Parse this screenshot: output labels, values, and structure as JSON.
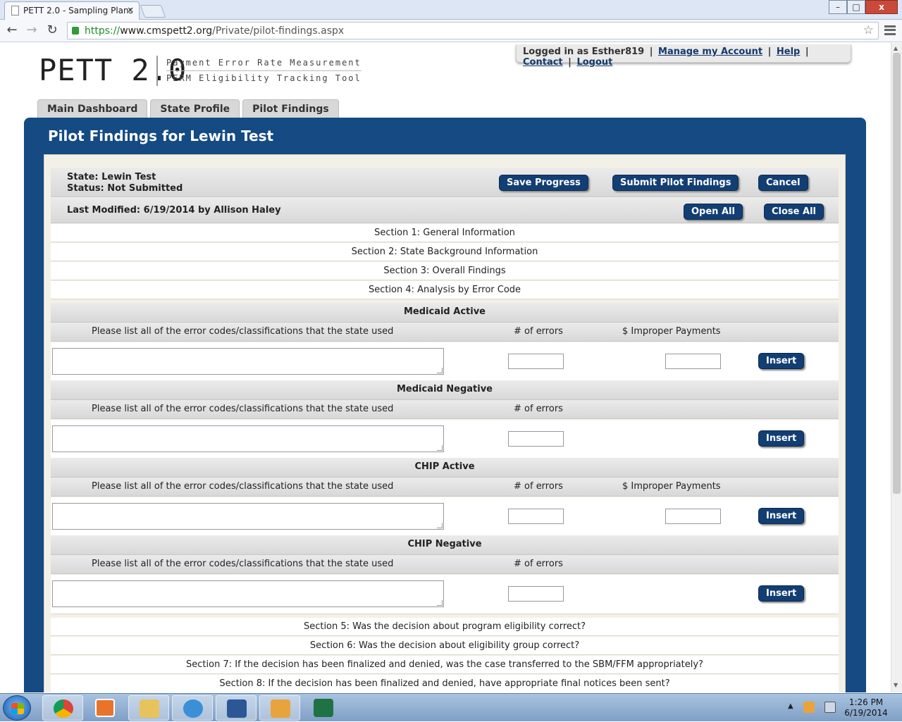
{
  "browser": {
    "tab_title": "PETT 2.0 - Sampling Plans",
    "tab_close": "×",
    "url_protocol": "https://",
    "url_domain": "www.cmspett2.org",
    "url_path": "/Private/pilot-findings.aspx",
    "back_glyph": "←",
    "forward_glyph": "→",
    "reload_glyph": "↻",
    "star_glyph": "☆",
    "min_glyph": "–",
    "max_glyph": "□",
    "close_glyph": "x"
  },
  "header": {
    "logo": "PETT 2.0",
    "logo_line1": "Payment Error Rate Measurement",
    "logo_line2": "PERM Eligibility Tracking Tool",
    "logged_in": "Logged in as Esther819",
    "links": [
      "Manage my Account",
      "Help",
      "Contact",
      "Logout"
    ],
    "sep": "|"
  },
  "nav_tabs": [
    "Main Dashboard",
    "State Profile",
    "Pilot Findings"
  ],
  "page": {
    "title": "Pilot Findings for Lewin Test",
    "state": "State: Lewin Test",
    "status": "Status: Not Submitted",
    "last_modified": "Last Modified: 6/19/2014 by Allison Haley",
    "buttons": {
      "save": "Save Progress",
      "submit": "Submit Pilot Findings",
      "cancel": "Cancel",
      "open_all": "Open All",
      "close_all": "Close All",
      "insert": "Insert"
    },
    "sections_top": [
      "Section 1: General Information",
      "Section 2: State Background Information",
      "Section 3: Overall Findings",
      "Section 4: Analysis by Error Code"
    ],
    "groups": [
      {
        "title": "Medicaid Active",
        "col_codes": "Please list all of the error codes/classifications that the state used",
        "col_errors": "# of errors",
        "col_payments": "$ Improper Payments"
      },
      {
        "title": "Medicaid Negative",
        "col_codes": "Please list all of the error codes/classifications that the state used",
        "col_errors": "# of errors"
      },
      {
        "title": "CHIP Active",
        "col_codes": "Please list all of the error codes/classifications that the state used",
        "col_errors": "# of errors",
        "col_payments": "$ Improper Payments"
      },
      {
        "title": "CHIP Negative",
        "col_codes": "Please list all of the error codes/classifications that the state used",
        "col_errors": "# of errors"
      }
    ],
    "sections_bottom": [
      "Section 5: Was the decision about program eligibility correct?",
      "Section 6: Was the decision about eligibility group correct?",
      "Section 7: If the decision has been finalized and denied, was the case transferred to the SBM/FFM appropriately?",
      "Section 8: If the decision has been finalized and denied, have appropriate final notices been sent?"
    ]
  },
  "taskbar": {
    "time": "1:26 PM",
    "date": "6/19/2014",
    "tray_up": "▲"
  },
  "colors": {
    "panel_blue": "#154a83",
    "button_navy": "#123e73",
    "link_blue": "#15396d"
  }
}
